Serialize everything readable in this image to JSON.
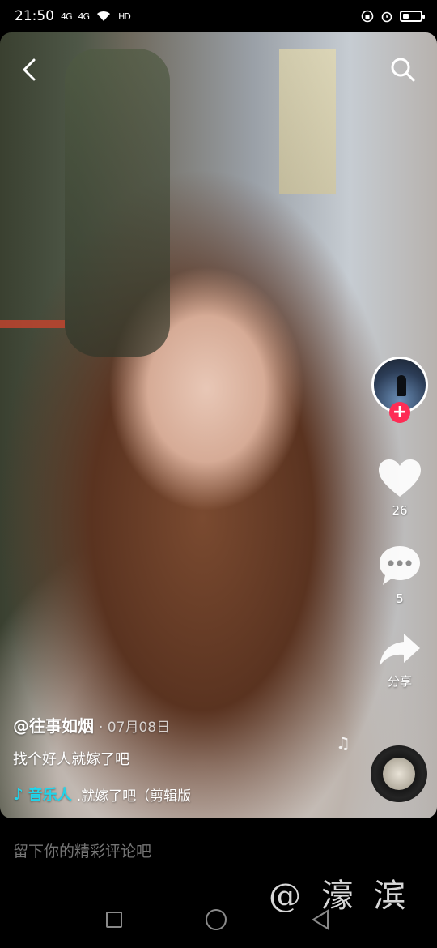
{
  "status_bar": {
    "time": "21:50",
    "signal_1": "4G",
    "signal_2": "4G",
    "hd": "HD"
  },
  "video": {
    "author": "@往事如烟",
    "date": "· 07月08日",
    "caption": "找个好人就嫁了吧",
    "music_label": "音乐人",
    "music_title": ".就嫁了吧（剪辑版"
  },
  "actions": {
    "likes": "26",
    "comments": "5",
    "share": "分享"
  },
  "comment_bar": {
    "placeholder": "留下你的精彩评论吧"
  },
  "watermark": "@ 濠 滨",
  "icons": [
    "back-icon",
    "search-icon",
    "heart-icon",
    "comment-icon",
    "share-icon",
    "music-note-icon",
    "plus-icon"
  ],
  "colors": {
    "accent": "#fe2c55",
    "music": "#20d5ec"
  }
}
